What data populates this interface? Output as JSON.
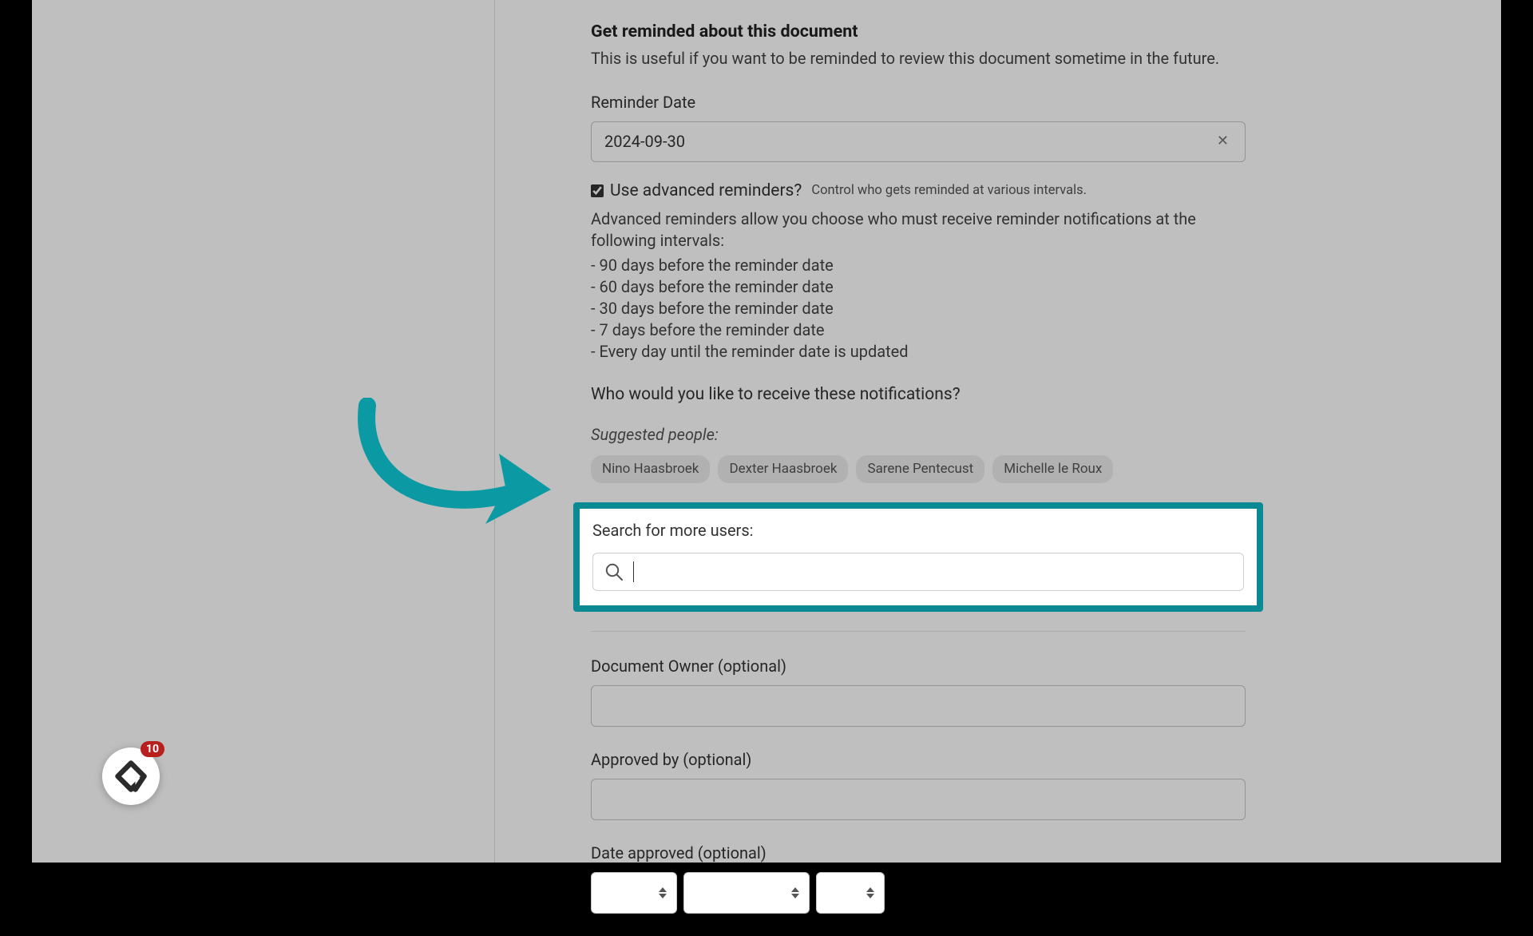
{
  "reminder": {
    "heading": "Get reminded about this document",
    "subtext": "This is useful if you want to be reminded to review this document sometime in the future.",
    "date_label": "Reminder Date",
    "date_value": "2024-09-30",
    "advanced": {
      "checkbox_label": "Use advanced reminders?",
      "hint": "Control who gets reminded at various intervals.",
      "checked": true,
      "description": "Advanced reminders allow you choose who must receive reminder notifications at the following intervals:",
      "intervals": [
        "- 90 days before the reminder date",
        "- 60 days before the reminder date",
        "- 30 days before the reminder date",
        "- 7 days before the reminder date",
        "- Every day until the reminder date is updated"
      ]
    },
    "notify_question": "Who would you like to receive these notifications?",
    "suggested_label": "Suggested people:",
    "suggested_people": [
      "Nino Haasbroek",
      "Dexter Haasbroek",
      "Sarene Pentecust",
      "Michelle le Roux"
    ],
    "search_label": "Search for more users:",
    "search_value": ""
  },
  "fields": {
    "owner_label": "Document Owner (optional)",
    "approved_by_label": "Approved by (optional)",
    "date_approved_label": "Date approved (optional)"
  },
  "fab": {
    "badge_count": "10"
  },
  "colors": {
    "highlight_border": "#0b8a93",
    "arrow": "#0b9aa3",
    "badge": "#b81f1f"
  }
}
